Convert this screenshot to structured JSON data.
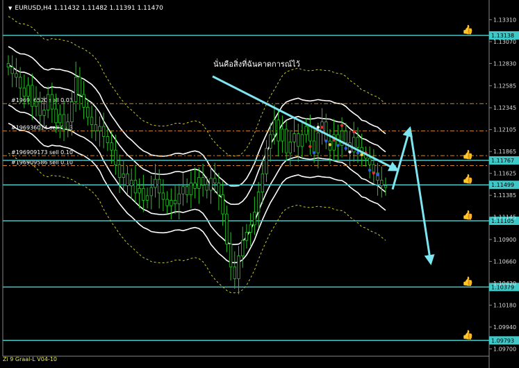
{
  "header": {
    "symbol_info": "EURUSD,H4  1.11432 1.11482 1.11391 1.11470"
  },
  "annotation": "นั่นคือสิ่งที่ฉันคาดการณ์ไว้",
  "footer": "Zi 9 Graal-L V04-10",
  "colors": {
    "background": "#000000",
    "candle": "#26c626",
    "level_line": "#3fc8c8",
    "bands": "#ffffff",
    "envelope": "#c8c832",
    "arrows": "#7ee6f0",
    "order_line": "#d4862b",
    "thumb_icon": "#6fd84a"
  },
  "icons": {
    "level_marker": "thumbs-up-icon",
    "symbol_marker": "triangle-down-icon"
  },
  "chart_data": {
    "type": "candlestick",
    "symbol": "EURUSD",
    "timeframe": "H4",
    "ohlc_last": {
      "open": 1.11432,
      "high": 1.11482,
      "low": 1.11391,
      "close": 1.1147
    },
    "ylim": [
      1.0962,
      1.1345
    ],
    "price_ticks": [
      "1.13310",
      "1.13070",
      "1.12830",
      "1.12585",
      "1.12345",
      "1.12105",
      "1.11865",
      "1.11625",
      "1.11385",
      "1.11145",
      "1.10900",
      "1.10660",
      "1.10420",
      "1.10180",
      "1.09940",
      "1.09700"
    ],
    "level_lines": [
      {
        "price": 1.13138,
        "label": "1.13138"
      },
      {
        "price": 1.11767,
        "label": "1.11767"
      },
      {
        "price": 1.11499,
        "label": "1.11499"
      },
      {
        "price": 1.11105,
        "label": "1.11105"
      },
      {
        "price": 1.10379,
        "label": "1.10379"
      },
      {
        "price": 1.09793,
        "label": "1.09793"
      }
    ],
    "order_labels": [
      "#196936520 sell 0.03",
      "#196936014 sell 0.03",
      "#196909173 sell 0.10",
      "#196909586 sell 0.10"
    ],
    "order_prices": [
      1.1239,
      1.1209,
      1.1182,
      1.1171
    ],
    "series": [
      {
        "type": "candle",
        "close": [
          1.1279,
          1.1272,
          1.1268,
          1.1256,
          1.1247,
          1.1259,
          1.1236,
          1.1241,
          1.1226,
          1.1232,
          1.1249,
          1.1233,
          1.1218,
          1.1227,
          1.1211,
          1.1219,
          1.1241,
          1.1268,
          1.1249,
          1.1235,
          1.1224,
          1.1216,
          1.1209,
          1.1214,
          1.1203,
          1.1196,
          1.1188,
          1.1172,
          1.1158,
          1.1162,
          1.1149,
          1.1155,
          1.1141,
          1.1146,
          1.1133,
          1.1138,
          1.1147,
          1.1156,
          1.1141,
          1.1134,
          1.1127,
          1.1133,
          1.1129,
          1.114,
          1.1148,
          1.1139,
          1.1152,
          1.1146,
          1.1158,
          1.115,
          1.1144,
          1.1157,
          1.1152,
          1.1139,
          1.1118,
          1.1085,
          1.106,
          1.1047,
          1.1072,
          1.1089,
          1.1098,
          1.1106,
          1.112,
          1.1142,
          1.1162,
          1.119,
          1.1205,
          1.1221,
          1.1198,
          1.1211,
          1.1185,
          1.1197,
          1.1206,
          1.1192,
          1.1205,
          1.1214,
          1.1198,
          1.1185,
          1.1207,
          1.1219,
          1.1198,
          1.1188,
          1.1205,
          1.1193,
          1.1209,
          1.1196,
          1.1186,
          1.1202,
          1.1191,
          1.1183,
          1.1179,
          1.1172,
          1.1163,
          1.1155,
          1.1149,
          1.1147
        ]
      }
    ],
    "forecast_arrows": [
      {
        "from_price": 1.1145,
        "to_price": 1.1212
      },
      {
        "from_price": 1.1212,
        "to_price": 1.1064
      }
    ]
  }
}
